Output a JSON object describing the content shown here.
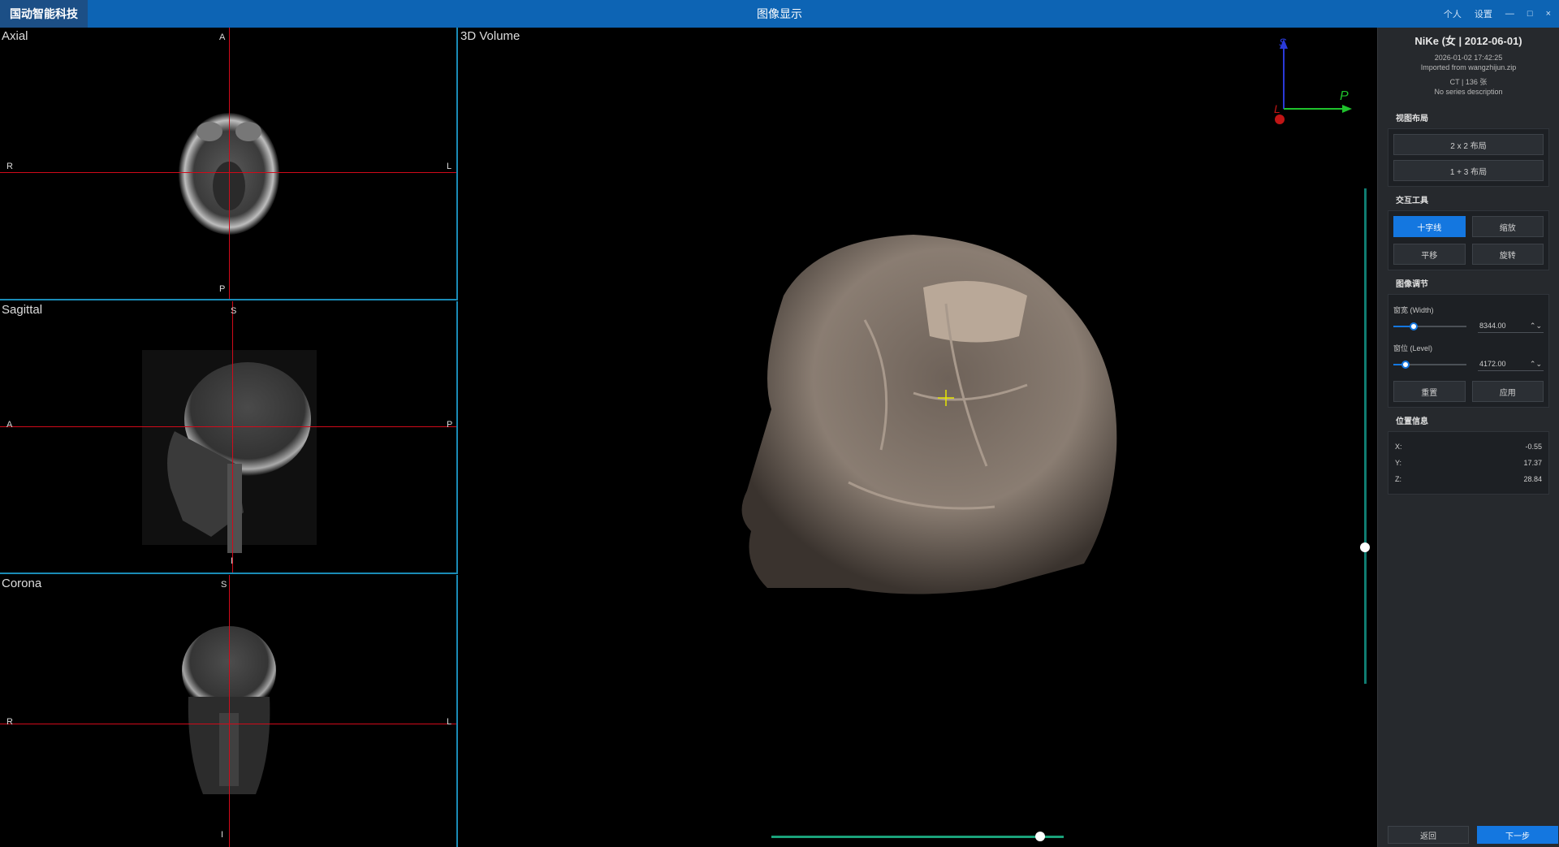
{
  "titlebar": {
    "brand": "国动智能科技",
    "title": "图像显示",
    "personal": "个人",
    "settings": "设置",
    "minimize": "—",
    "maximize": "□",
    "close": "×"
  },
  "viewports": {
    "axial": {
      "label": "Axial",
      "top": "A",
      "bottom": "P",
      "left": "R",
      "right": "L"
    },
    "sagittal": {
      "label": "Sagittal",
      "top": "S",
      "bottom": "I",
      "left": "A",
      "right": "P"
    },
    "coronal": {
      "label": "Corona",
      "top": "S",
      "bottom": "I",
      "left": "R",
      "right": "L"
    },
    "volume": {
      "label": "3D Volume",
      "axis_s": "S",
      "axis_p": "P",
      "axis_l": "L"
    }
  },
  "patient": {
    "name": "NiKe (女 | 2012-06-01)",
    "date": "2026-01-02 17:42:25",
    "imported": "Imported from wangzhijun.zip",
    "modality": "CT | 136 张",
    "series": "No series description"
  },
  "layout_section": {
    "title": "视图布局",
    "btn_2x2": "2 x 2 布局",
    "btn_1x3": "1 + 3 布局"
  },
  "tools_section": {
    "title": "交互工具",
    "tools": [
      "十字线",
      "缩放",
      "平移",
      "旋转"
    ],
    "active_tool": "十字线"
  },
  "adjust_section": {
    "title": "图像调节",
    "width_label": "窗宽 (Width)",
    "width_value": "8344.00",
    "width_level": 0.28,
    "level_label": "窗位 (Level)",
    "level_value": "4172.00",
    "level_level": 0.17,
    "reset": "重置",
    "apply": "应用"
  },
  "position_section": {
    "title": "位置信息",
    "x_label": "X:",
    "x_value": "-0.55",
    "y_label": "Y:",
    "y_value": "17.37",
    "z_label": "Z:",
    "z_value": "28.84"
  },
  "footer": {
    "back": "返回",
    "next": "下一步"
  },
  "colors": {
    "titlebar": "#0d64b4",
    "crosshair": "#d10a1a",
    "accent": "#1477e0",
    "viewport_border": "#1a8bb6"
  }
}
